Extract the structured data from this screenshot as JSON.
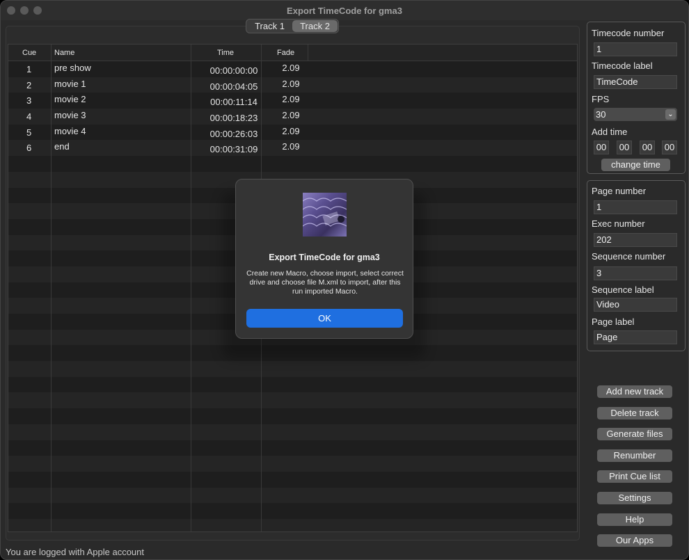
{
  "window": {
    "title": "Export TimeCode for gma3"
  },
  "tabs": [
    {
      "label": "Track 1"
    },
    {
      "label": "Track 2"
    }
  ],
  "table": {
    "headers": {
      "cue": "Cue",
      "name": "Name",
      "time": "Time",
      "fade": "Fade"
    },
    "rows": [
      {
        "cue": "1",
        "name": "pre show",
        "time": "00:00:00:00",
        "fade": "2.09"
      },
      {
        "cue": "2",
        "name": "movie 1",
        "time": "00:00:04:05",
        "fade": "2.09"
      },
      {
        "cue": "3",
        "name": "movie 2",
        "time": "00:00:11:14",
        "fade": "2.09"
      },
      {
        "cue": "4",
        "name": "movie 3",
        "time": "00:00:18:23",
        "fade": "2.09"
      },
      {
        "cue": "5",
        "name": "movie 4",
        "time": "00:00:26:03",
        "fade": "2.09"
      },
      {
        "cue": "6",
        "name": "end",
        "time": "00:00:31:09",
        "fade": "2.09"
      }
    ]
  },
  "timecode_panel": {
    "tc_number_label": "Timecode number",
    "tc_number_value": "1",
    "tc_label_label": "Timecode label",
    "tc_label_value": "TimeCode",
    "fps_label": "FPS",
    "fps_value": "30",
    "add_time_label": "Add time",
    "add_time": [
      "00",
      "00",
      "00",
      "00"
    ],
    "change_time_button": "change time"
  },
  "page_panel": {
    "page_number_label": "Page number",
    "page_number_value": "1",
    "exec_number_label": "Exec number",
    "exec_number_value": "202",
    "seq_number_label": "Sequence number",
    "seq_number_value": "3",
    "seq_label_label": "Sequence label",
    "seq_label_value": "Video",
    "page_label_label": "Page label",
    "page_label_value": "Page"
  },
  "actions": {
    "add_track": "Add new track",
    "delete_track": "Delete track",
    "generate_files": "Generate files",
    "renumber": "Renumber",
    "print_cue_list": "Print Cue list",
    "settings": "Settings",
    "help": "Help",
    "our_apps": "Our Apps"
  },
  "modal": {
    "title": "Export TimeCode for gma3",
    "message": "Create new Macro, choose import, select correct drive and choose file M.xml to import, after this run imported Macro.",
    "ok_button": "OK"
  },
  "status": {
    "text": "You are logged with Apple account"
  },
  "colors": {
    "accent": "#1f6fe0",
    "window_bg": "#2a2a2a"
  }
}
